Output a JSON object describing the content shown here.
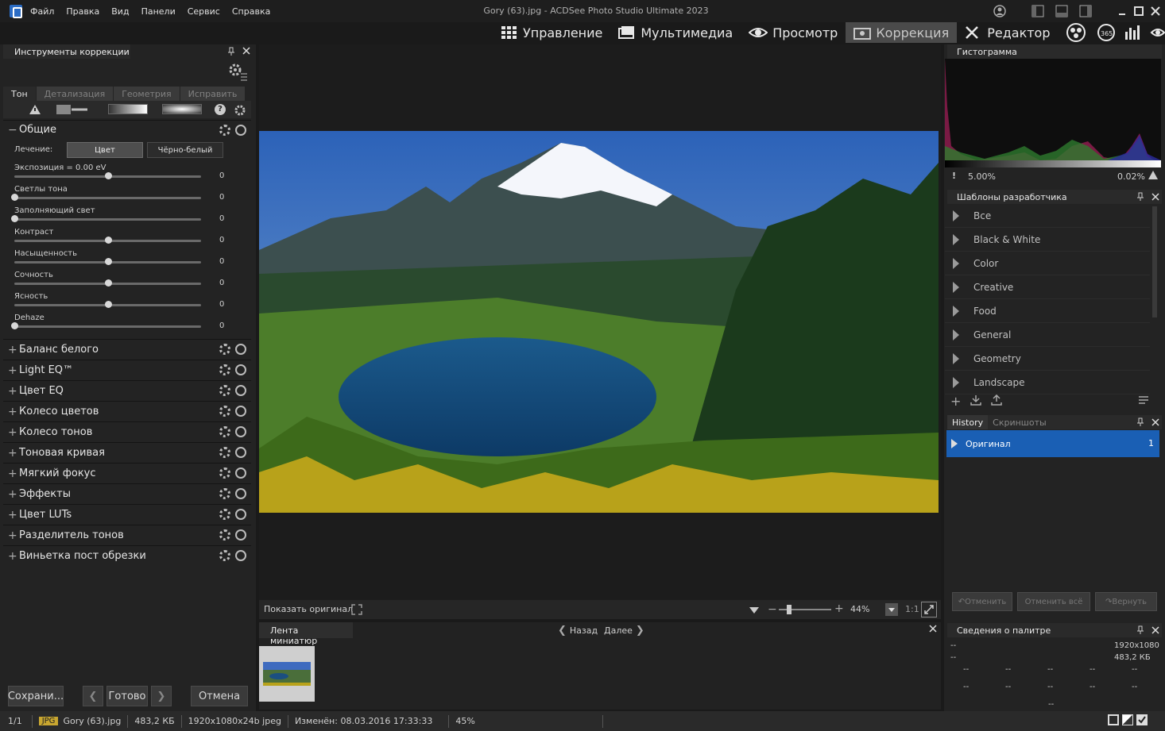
{
  "window": {
    "title": "Gory (63).jpg - ACDSee Photo Studio Ultimate 2023",
    "menu": [
      "Файл",
      "Правка",
      "Вид",
      "Панели",
      "Сервис",
      "Справка"
    ]
  },
  "modes": [
    {
      "label": "Управление",
      "icon": "grid-icon"
    },
    {
      "label": "Мультимедиа",
      "icon": "media-icon"
    },
    {
      "label": "Просмотр",
      "icon": "eye-icon"
    },
    {
      "label": "Коррекция",
      "icon": "develop-icon",
      "active": true
    },
    {
      "label": "Редактор",
      "icon": "edit-icon"
    }
  ],
  "left_panel": {
    "title": "Инструменты коррекции",
    "tabs": [
      "Тон",
      "Детализация",
      "Геометрия",
      "Исправить"
    ],
    "general_section": "Общие",
    "treatment_label": "Лечение:",
    "treatment_color": "Цвет",
    "treatment_bw": "Чёрно-белый",
    "sliders": [
      {
        "label": "Экспозиция = 0.00 eV",
        "value": "0",
        "pos": 0.5
      },
      {
        "label": "Светлы тона",
        "value": "0",
        "pos": 0.0
      },
      {
        "label": "Заполняющий свет",
        "value": "0",
        "pos": 0.0
      },
      {
        "label": "Контраст",
        "value": "0",
        "pos": 0.5
      },
      {
        "label": "Насыщенность",
        "value": "0",
        "pos": 0.5
      },
      {
        "label": "Сочность",
        "value": "0",
        "pos": 0.5
      },
      {
        "label": "Ясность",
        "value": "0",
        "pos": 0.5
      },
      {
        "label": "Dehaze",
        "value": "0",
        "pos": 0.0
      }
    ],
    "sections": [
      "Баланс белого",
      "Light EQ™",
      "Цвет EQ",
      "Колесо цветов",
      "Колесо тонов",
      "Тоновая кривая",
      "Мягкий фокус",
      "Эффекты",
      "Цвет LUTs",
      "Разделитель тонов",
      "Виньетка пост обрезки"
    ],
    "save_btn": "Сохрани...",
    "done_btn": "Готово",
    "cancel_btn": "Отмена"
  },
  "center": {
    "show_original": "Показать оригинал",
    "zoom": "44%",
    "one_to_one": "1:1",
    "filmstrip_title": "Лента миниатюр",
    "prev": "Назад",
    "next": "Далее"
  },
  "right_panel": {
    "histogram_title": "Гистограмма",
    "hist_left": "5.00%",
    "hist_right": "0.02%",
    "presets_title": "Шаблоны разработчика",
    "presets": [
      "Все",
      "Black & White",
      "Color",
      "Creative",
      "Food",
      "General",
      "Geometry",
      "Landscape"
    ],
    "history_tab": "History",
    "screenshots_tab": "Скриншоты",
    "history_items": [
      {
        "label": "Оригинал",
        "num": "1"
      }
    ],
    "undo": "Отменить",
    "undo_all": "Отменить всё",
    "redo": "Вернуть",
    "palette_title": "Сведения о палитре",
    "palette_dims": "1920x1080",
    "palette_size": "483,2 КБ",
    "palette_dash": "--"
  },
  "status": {
    "count": "1/1",
    "format": "JPG",
    "filename": "Gory (63).jpg",
    "size": "483,2 КБ",
    "info": "1920x1080x24b jpeg",
    "modified": "Изменён: 08.03.2016 17:33:33",
    "zoom": "45%"
  },
  "colors": {
    "accent": "#1a5fb4",
    "active_tab": "#4a4a4a"
  }
}
